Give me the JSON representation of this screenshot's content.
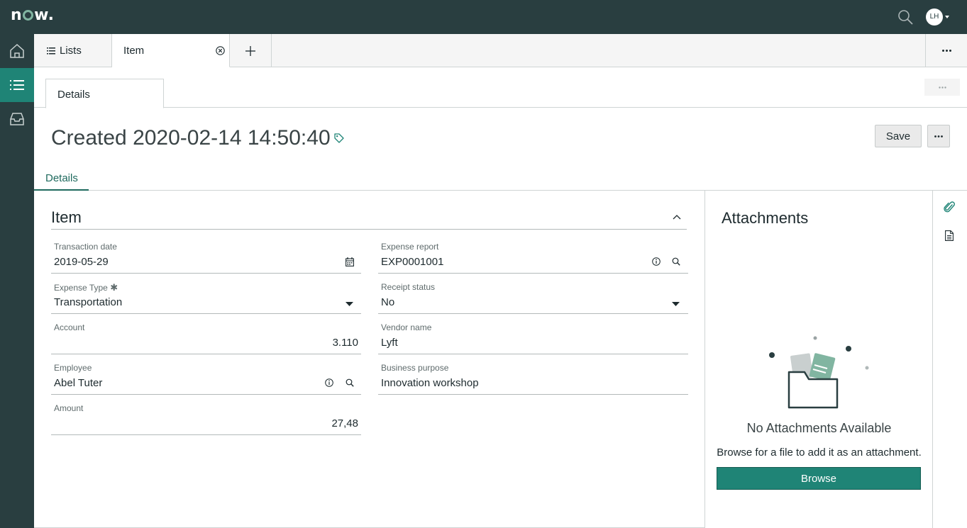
{
  "header": {
    "logo": "now",
    "avatar_initials": "LH"
  },
  "tabs": {
    "lists_label": "Lists",
    "item_label": "Item"
  },
  "subtab": {
    "label": "Details"
  },
  "record": {
    "title": "Created 2020-02-14 14:50:40",
    "save_label": "Save"
  },
  "form_tab": {
    "label": "Details"
  },
  "section": {
    "title": "Item"
  },
  "fields": {
    "transaction_date": {
      "label": "Transaction date",
      "value": "2019-05-29"
    },
    "expense_type": {
      "label": "Expense Type",
      "value": "Transportation"
    },
    "account": {
      "label": "Account",
      "value": "3.110"
    },
    "employee": {
      "label": "Employee",
      "value": "Abel Tuter"
    },
    "amount": {
      "label": "Amount",
      "value": "27,48"
    },
    "expense_report": {
      "label": "Expense report",
      "value": "EXP0001001"
    },
    "receipt_status": {
      "label": "Receipt status",
      "value": "No"
    },
    "vendor_name": {
      "label": "Vendor name",
      "value": "Lyft"
    },
    "business_purpose": {
      "label": "Business purpose",
      "value": "Innovation workshop"
    }
  },
  "attachments": {
    "title": "Attachments",
    "empty_title": "No Attachments Available",
    "empty_desc": "Browse for a file to add it as an attachment.",
    "browse_label": "Browse"
  },
  "colors": {
    "header": "#293e40",
    "accent": "#1f8476",
    "logo_o": "#81b5a1"
  },
  "icons": [
    "search-icon",
    "home-icon",
    "list-icon",
    "inbox-icon",
    "close-icon",
    "plus-icon",
    "more-icon",
    "tag-icon",
    "calendar-icon",
    "info-icon",
    "chevron-down-icon",
    "chevron-up-icon",
    "paperclip-icon",
    "document-icon"
  ]
}
